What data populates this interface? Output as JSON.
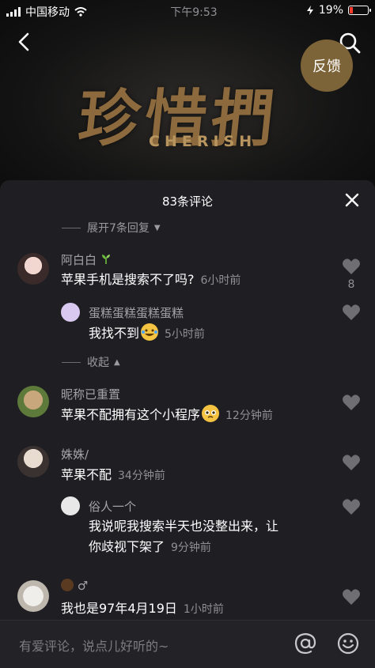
{
  "status_bar": {
    "carrier": "中国移动",
    "time": "下午9:53",
    "battery": "19%",
    "battery_level": 0.19
  },
  "video": {
    "title_art": "珍惜捫",
    "title_sub": "CHERISH",
    "feedback_label": "反馈"
  },
  "sheet": {
    "title": "83条评论",
    "expand_label": "展开7条回复",
    "collapse_label": "收起",
    "comments": [
      {
        "name": "阿白白",
        "text": "苹果手机是搜索不了吗?",
        "time": "6小时前",
        "likes": "8"
      },
      {
        "name": "蛋糕蛋糕蛋糕蛋糕",
        "text": "我找不到",
        "time": "5小时前"
      },
      {
        "name": "昵称已重置",
        "text": "苹果不配拥有这个小程序",
        "time": "12分钟前"
      },
      {
        "name": "姝姝/",
        "text": "苹果不配",
        "time": "34分钟前"
      },
      {
        "name": "俗人一个",
        "text_line1": "我说呢我搜索半天也没整出来，让",
        "text_line2": "你歧视下架了",
        "time": "9分钟前"
      },
      {
        "name": "♂",
        "text": "我也是97年4月19日",
        "time": "1小时前"
      }
    ]
  },
  "input": {
    "placeholder": "有爱评论，说点儿好听的~"
  },
  "icons": {
    "back": "back-arrow-icon",
    "search": "search-icon",
    "close": "close-icon",
    "heart": "heart-icon",
    "at": "at-icon",
    "emoji": "emoji-icon",
    "sprout": "sprout-icon"
  },
  "colors": {
    "accent_gold": "#8c6a3e",
    "sheet_bg": "#1f1f23",
    "heart": "#6e6e73",
    "battery_low": "#ff3b30"
  }
}
